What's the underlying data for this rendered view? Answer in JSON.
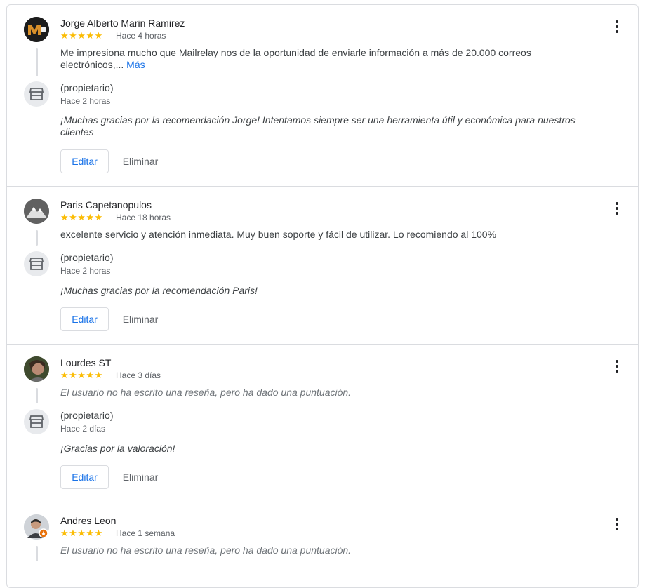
{
  "reviews": [
    {
      "name": "Jorge Alberto Marin Ramirez",
      "stars": "★★★★★",
      "rating": 5,
      "time": "Hace 4 horas",
      "text": "Me impresiona mucho que Mailrelay nos de la oportunidad de enviarle información a más de 20.000 correos electrónicos,...",
      "more": "Más",
      "owner_label": "(propietario)",
      "owner_time": "Hace 2 horas",
      "reply": "¡Muchas gracias por la recomendación Jorge! Intentamos siempre ser una herramienta útil y económica para nuestros clientes",
      "edit": "Editar",
      "delete": "Eliminar"
    },
    {
      "name": "Paris Capetanopulos",
      "stars": "★★★★★",
      "rating": 5,
      "time": "Hace 18 horas",
      "text": "excelente servicio y atención inmediata. Muy buen soporte y fácil de utilizar. Lo recomiendo al 100%",
      "owner_label": "(propietario)",
      "owner_time": "Hace 2 horas",
      "reply": "¡Muchas gracias por la recomendación Paris!",
      "edit": "Editar",
      "delete": "Eliminar"
    },
    {
      "name": "Lourdes ST",
      "stars": "★★★★★",
      "rating": 5,
      "time": "Hace 3 días",
      "text": "El usuario no ha escrito una reseña, pero ha dado una puntuación.",
      "owner_label": "(propietario)",
      "owner_time": "Hace 2 días",
      "reply": "¡Gracias por la valoración!",
      "edit": "Editar",
      "delete": "Eliminar"
    },
    {
      "name": "Andres Leon",
      "stars": "★★★★★",
      "rating": 5,
      "time": "Hace 1 semana",
      "text": "El usuario no ha escrito una reseña, pero ha dado una puntuación."
    }
  ],
  "colors": {
    "star": "#fbbc04",
    "link": "#1a73e8",
    "divider": "#dadce0"
  }
}
